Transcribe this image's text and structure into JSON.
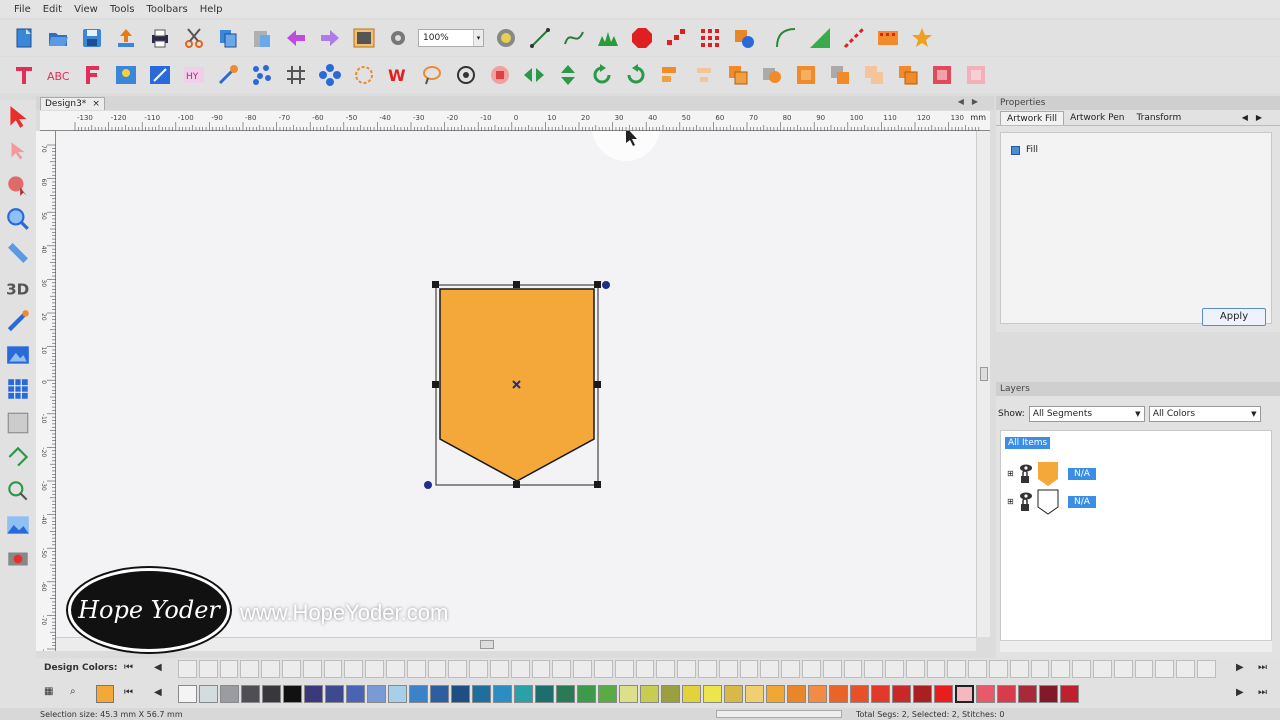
{
  "menu": [
    "File",
    "Edit",
    "View",
    "Tools",
    "Toolbars",
    "Help"
  ],
  "toolbar": {
    "zoom_value": "100%"
  },
  "document": {
    "tab_title": "Design3*",
    "close_symbol": "×",
    "ruler_unit": "mm"
  },
  "ruler": {
    "h_labels": [
      "-130",
      "-120",
      "-110",
      "-100",
      "-90",
      "-80",
      "-70",
      "-60",
      "-50",
      "-40",
      "-30",
      "-20",
      "-10",
      "0",
      "10",
      "20",
      "30",
      "40",
      "50",
      "60",
      "70",
      "80",
      "90",
      "100",
      "110",
      "120",
      "130"
    ],
    "v_labels": [
      "70",
      "60",
      "50",
      "40",
      "30",
      "20",
      "10",
      "0",
      "-10",
      "-20",
      "-30",
      "-40",
      "-50",
      "-60",
      "-70",
      "-80",
      "-90",
      "-100"
    ]
  },
  "shape": {
    "fill_color": "#F5A83A",
    "outline_color": "#1a1a1a",
    "handle_color": "#1a1a1a",
    "rotate_handle_color": "#1f2f8a"
  },
  "watermark": {
    "logo_text": "Hope Yoder",
    "url": "www.HopeYoder.com"
  },
  "properties": {
    "title": "Properties",
    "tabs": [
      "Artwork Fill",
      "Artwork Pen",
      "Transform"
    ],
    "fill_label": "Fill",
    "apply_label": "Apply"
  },
  "layers": {
    "title": "Layers",
    "show_label": "Show:",
    "segments_value": "All Segments",
    "colors_value": "All Colors",
    "all_items_label": "All Items",
    "rows": [
      {
        "label": "N/A",
        "thumb_color": "#F5A83A"
      },
      {
        "label": "N/A",
        "thumb_color": "#ffffff"
      }
    ]
  },
  "colors": {
    "design_colors_label": "Design Colors:",
    "palette": [
      "#f4f4f4",
      "#d3dcdf",
      "#9a9ca2",
      "#4e4e54",
      "#38383c",
      "#111111",
      "#3a3a7a",
      "#3d4b8e",
      "#4a64b4",
      "#7a9ad6",
      "#a6d0e8",
      "#3c82c8",
      "#2d5fa0",
      "#1f4e82",
      "#1f6e9c",
      "#2d8cc2",
      "#2ba0a8",
      "#1e6e6e",
      "#2a7a56",
      "#3c9a4a",
      "#5aaa46",
      "#dce08a",
      "#c8cc50",
      "#9aa040",
      "#e2d23c",
      "#ece64c",
      "#d8b848",
      "#efcf72",
      "#f0a832",
      "#e8862a",
      "#f08c46",
      "#e86428",
      "#e8502a",
      "#e03a2a",
      "#c82828",
      "#a82020",
      "#e81e1e",
      "#f4b8c0",
      "#e85a6a",
      "#d83c4c",
      "#a82a3a",
      "#801a2a",
      "#bf2030"
    ],
    "selected_swatch_index": 37
  },
  "status": {
    "left_text": "Selection size: 45.3 mm X 56.7 mm",
    "right_text": "Total Segs: 2, Selected: 2, Stitches: 0"
  }
}
